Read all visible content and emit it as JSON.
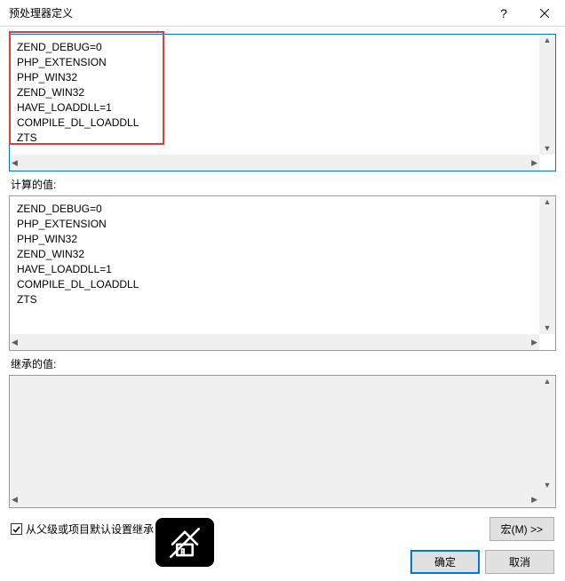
{
  "window": {
    "title": "预处理器定义",
    "help_glyph": "?",
    "close_tooltip": "Close"
  },
  "editor": {
    "text": "ZEND_DEBUG=0\nPHP_EXTENSION\nPHP_WIN32\nZEND_WIN32\nHAVE_LOADDLL=1\nCOMPILE_DL_LOADDLL\nZTS"
  },
  "sections": {
    "computed_label": "计算的值:",
    "computed_text": "ZEND_DEBUG=0\nPHP_EXTENSION\nPHP_WIN32\nZEND_WIN32\nHAVE_LOADDLL=1\nCOMPILE_DL_LOADDLL\nZTS",
    "inherited_label": "继承的值:",
    "inherited_text": ""
  },
  "footer": {
    "inherit_label": "从父级或项目默认设置继承",
    "inherit_checked": true,
    "macro_button": "宏(M) >>"
  },
  "buttons": {
    "ok": "确定",
    "cancel": "取消"
  }
}
